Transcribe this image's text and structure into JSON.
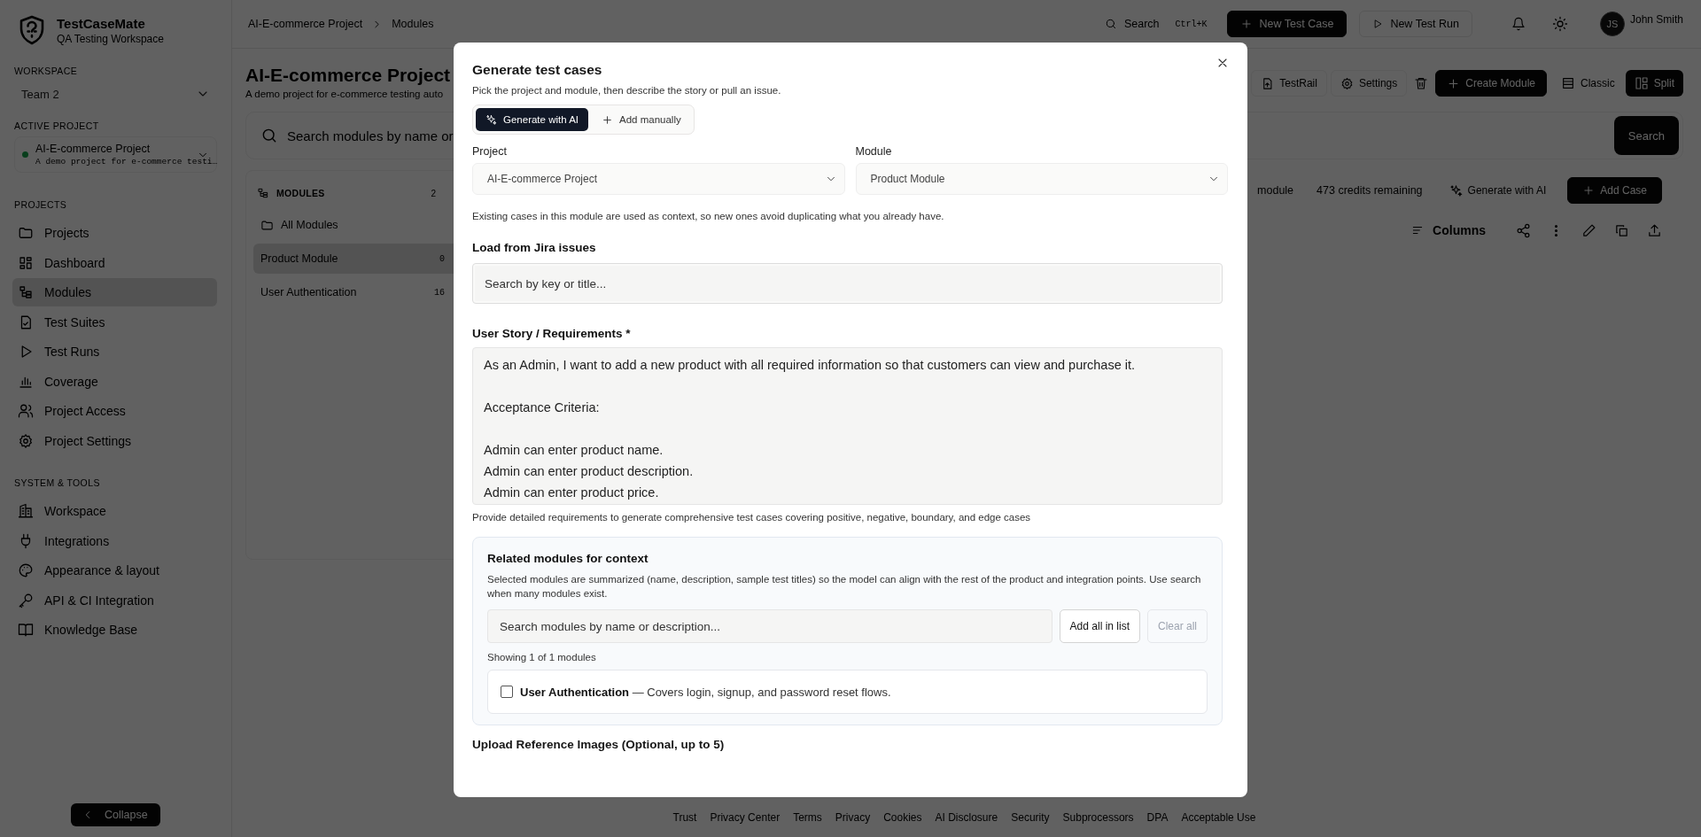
{
  "sidebar": {
    "brand": "TestCaseMate",
    "tagline": "QA Testing Workspace",
    "workspace_label": "WORKSPACE",
    "workspace": "Team 2",
    "active_project_label": "ACTIVE PROJECT",
    "active_project": {
      "name": "AI-E-commerce Project",
      "description": "A demo project for e-commerce testi…"
    },
    "sections": [
      {
        "title": "PROJECTS",
        "items": [
          {
            "label": "Projects",
            "selected": false
          },
          {
            "label": "Dashboard",
            "selected": false
          },
          {
            "label": "Modules",
            "selected": true
          },
          {
            "label": "Test Suites",
            "selected": false
          },
          {
            "label": "Test Runs",
            "selected": false
          },
          {
            "label": "Coverage",
            "selected": false
          },
          {
            "label": "Project Access",
            "selected": false
          },
          {
            "label": "Project Settings",
            "selected": false
          }
        ]
      },
      {
        "title": "SYSTEM & TOOLS",
        "items": [
          {
            "label": "Workspace",
            "selected": false
          },
          {
            "label": "Integrations",
            "selected": false
          },
          {
            "label": "Appearance & layout",
            "selected": false
          },
          {
            "label": "API & CI Integration",
            "selected": false
          },
          {
            "label": "Knowledge Base",
            "selected": false
          }
        ]
      }
    ],
    "collapse": "Collapse"
  },
  "topbar": {
    "breadcrumb": [
      "AI-E-commerce Project",
      "Modules"
    ],
    "search": "Search",
    "shortcut": "Ctrl+K",
    "new_case": "New Test Case",
    "new_run": "New Test Run",
    "avatar": "JS",
    "user": "John Smith"
  },
  "page": {
    "title": "AI-E-commerce Project",
    "subtitle": "A demo project for e-commerce testing auto",
    "testrail": "TestRail",
    "settings": "Settings",
    "create_module": "Create Module",
    "views": [
      {
        "label": "Classic",
        "selected": false
      },
      {
        "label": "Split",
        "selected": true
      }
    ],
    "search_placeholder": "Search modules by name or",
    "search_button": "Search",
    "modules": {
      "title": "MODULES",
      "count": "2",
      "items": [
        {
          "label": "All Modules",
          "selected": false
        },
        {
          "label": "Product Module",
          "count": "0",
          "selected": true
        },
        {
          "label": "User Authentication",
          "count": "16",
          "selected": false
        }
      ]
    },
    "cases_toolbar": {
      "filter": "module",
      "credits": "473 credits remaining",
      "generate": "Generate with AI",
      "add_case": "Add Case",
      "columns": "Columns"
    },
    "footer": [
      "Trust",
      "Privacy Center",
      "Terms",
      "Privacy",
      "Cookies",
      "AI Disclosure",
      "Security",
      "Subprocessors",
      "DPA",
      "Acceptable Use"
    ]
  },
  "modal": {
    "title": "Generate test cases",
    "subtitle": "Pick the project and module, then describe the story or pull an issue.",
    "modes": [
      {
        "label": "Generate with AI",
        "selected": true
      },
      {
        "label": "Add manually",
        "selected": false
      }
    ],
    "project": {
      "label": "Project",
      "value": "AI-E-commerce Project"
    },
    "module": {
      "label": "Module",
      "value": "Product Module"
    },
    "context_note": "Existing cases in this module are used as context, so new ones avoid duplicating what you already have.",
    "jira": {
      "label": "Load from Jira issues",
      "placeholder": "Search by key or title..."
    },
    "story": {
      "label": "User Story / Requirements *",
      "value": "As an Admin, I want to add a new product with all required information so that customers can view and purchase it.\n\nAcceptance Criteria:\n\nAdmin can enter product name.\nAdmin can enter product description.\nAdmin can enter product price.",
      "hint": "Provide detailed requirements to generate comprehensive test cases covering positive, negative, boundary, and edge cases"
    },
    "related": {
      "title": "Related modules for context",
      "description": "Selected modules are summarized (name, description, sample test titles) so the model can align with the rest of the product and integration points. Use search when many modules exist.",
      "search_placeholder": "Search modules by name or description...",
      "add_all": "Add all in list",
      "clear_all": "Clear all",
      "clear_disabled": true,
      "showing": "Showing 1 of 1 modules",
      "modules": [
        {
          "label": "**User Authentication** — Covers login, signup, and password reset flows.",
          "checked": false
        }
      ]
    },
    "upload_label": "Upload Reference Images (Optional, up to 5)"
  }
}
